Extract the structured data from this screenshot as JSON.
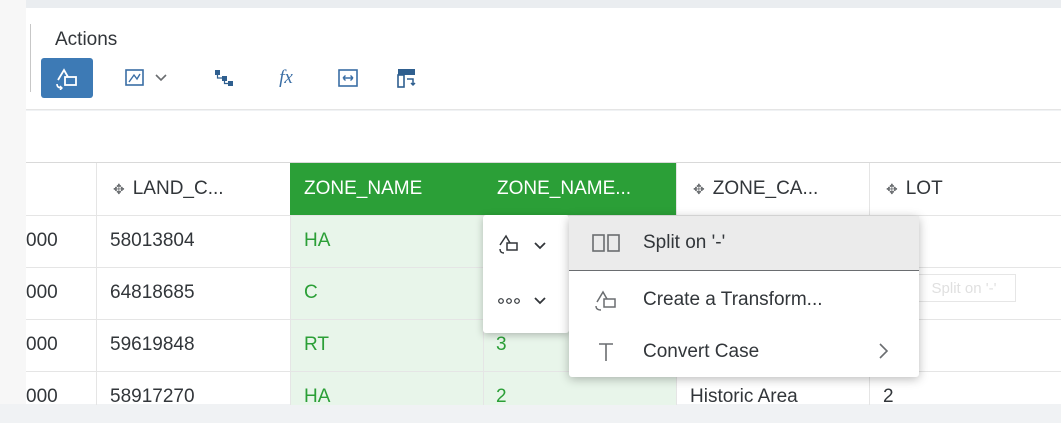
{
  "toolbar": {
    "section_label": "Actions",
    "buttons": [
      {
        "name": "transform-icon",
        "active": true
      },
      {
        "name": "image-filter-icon",
        "has_dropdown": true
      },
      {
        "name": "hierarchy-icon"
      },
      {
        "name": "formula-icon",
        "label": "fx"
      },
      {
        "name": "fit-width-icon"
      },
      {
        "name": "split-column-icon"
      }
    ]
  },
  "grid": {
    "columns": [
      {
        "label": "",
        "icon": ""
      },
      {
        "label": "LAND_C...",
        "icon": "dimension-icon"
      },
      {
        "label": "ZONE_NAME",
        "selected": true
      },
      {
        "label": "ZONE_NAME...",
        "selected": true
      },
      {
        "label": "ZONE_CA...",
        "icon": "dimension-icon"
      },
      {
        "label": "LOT",
        "icon": "dimension-icon"
      }
    ],
    "rows": [
      {
        "c0": "000",
        "c1": "58013804",
        "c2": "HA",
        "c3": "",
        "c4": "",
        "c5": ""
      },
      {
        "c0": "000",
        "c1": "64818685",
        "c2": "C",
        "c3": "",
        "c4": "",
        "c5": ""
      },
      {
        "c0": "000",
        "c1": "59619848",
        "c2": "RT",
        "c3": "3",
        "c4": "",
        "c5": ""
      },
      {
        "c0": "000",
        "c1": "58917270",
        "c2": "HA",
        "c3": "2",
        "c4": "Historic Area",
        "c5": "2"
      }
    ]
  },
  "popup": {
    "buttons": [
      {
        "name": "transform-menu-icon",
        "has_dropdown": true
      },
      {
        "name": "more-icon",
        "has_dropdown": true
      }
    ]
  },
  "context_menu": {
    "items": [
      {
        "label": "Split on '-'",
        "icon": "split-icon",
        "highlighted": true
      },
      {
        "label": "Create a Transform...",
        "icon": "transform-icon"
      },
      {
        "label": "Convert Case",
        "icon": "text-case-icon",
        "has_submenu": true
      }
    ]
  },
  "ghost_tooltip": "Split on '-'",
  "colors": {
    "accent_green": "#2b9f37",
    "selected_cell_bg": "#e8f5ea",
    "active_button": "#3d7ab5"
  }
}
